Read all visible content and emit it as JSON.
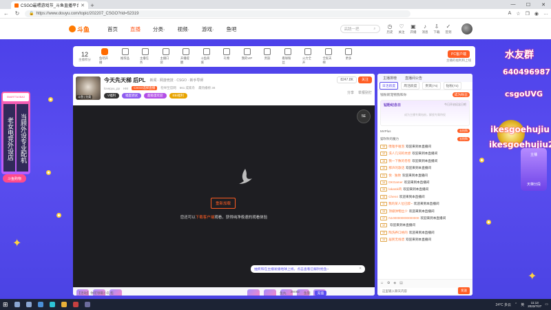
{
  "browser": {
    "tab_title": "CSGO最喂游戏节_斗鱼直播平台",
    "url": "https://www.douyu.com/topic/202207_CSGO?rid=52319"
  },
  "site": {
    "logo": "斗鱼",
    "nav": [
      "首页",
      "直播",
      "分类·",
      "视频·",
      "游戏·",
      "鱼吧"
    ],
    "search_placeholder": "高跷一把",
    "header_icons": [
      "历史",
      "关注",
      "开播",
      "消息",
      "下载",
      "签到"
    ]
  },
  "categories": {
    "rank_value": "12",
    "rank_label": "主播积分",
    "items": [
      "鱼吧开播",
      "推荐品",
      "主播任务",
      "主播口袋",
      "开播提醒",
      "斗鱼商城",
      "礼物",
      "我的VIP",
      "贵族",
      "看球粉丝",
      "火力全开",
      "全民天梯",
      "更多"
    ],
    "pc_button": "PC客户端",
    "pc_sub": "主播的福利和上线"
  },
  "anchor": {
    "name": "今天先天梯 后PL",
    "category": "新闻 · 网游竞技 · CSGO · 新手导师",
    "id_text": "lovepyu_pp",
    "level_text": "HM",
    "tag": "CSGO选择直播",
    "report": "检举至官网",
    "fans": "661 成家舟",
    "hot": "最热播榜 38",
    "pill_v": "V福利",
    "pill_1": "福蛋调试",
    "pill_2": "超级蛋欢迎",
    "pill_3": "EBI福利",
    "follow_count": "8247.8K",
    "follow_btn": "关注",
    "share": "分享",
    "report2": "举报别打",
    "thumb_label": "斗鱼 | 分类"
  },
  "player": {
    "retry": "重新加载",
    "message_prefix": "您还可以",
    "message_link": "下载客户端",
    "message_suffix": "观看，获得纯净极速的观看体验",
    "notice": "抽奖和在主播发播地球上线，点击查看已解封抢鱼~",
    "badge": "5E"
  },
  "chat": {
    "top_left": "主播排榜",
    "top_right": "直播间公告",
    "tabs": [
      "日活跃度",
      "周活跃度",
      "贵宾(74)",
      "钻粉(72)"
    ],
    "fans_text": "钱粉新宠物我和你",
    "fans_btn": "成为粉丝",
    "banner_title": "钻粉纪念日",
    "banner_date": "今日开启纪念日吧",
    "banner_caption": "成为主播专属钻粉，解锁专属特权",
    "feat_1": "MVPlus",
    "feat_2": "猫吹吹的魔力",
    "feat_btn": "去抢购",
    "welcome": "欢迎来到本直播间",
    "messages": [
      {
        "lv": "15",
        "nick": "噗嗤手嗞泡",
        "txt": "欢迎来到本直播间"
      },
      {
        "lv": "12",
        "nick": "洗人几词的坑想",
        "txt": "欢迎来到本直播间"
      },
      {
        "lv": "18",
        "nick": "我一下数的卷卷",
        "txt": "欢迎来到本直播间"
      },
      {
        "lv": "10",
        "nick": "那声的歌话",
        "txt": "欢迎来到本直播间"
      },
      {
        "lv": "21",
        "nick": "悦 · 独致",
        "txt": "欢迎来到本直播间"
      },
      {
        "lv": "14",
        "nick": "DKGamer",
        "txt": "欢迎来到本直播间"
      },
      {
        "lv": "19",
        "nick": "lakatok鸡",
        "txt": "欢迎来到本直播间"
      },
      {
        "lv": "16",
        "nick": "Chen4",
        "txt": "欢迎来到本直播间"
      },
      {
        "lv": "11",
        "nick": "我的某人位已醉~",
        "txt": "欢迎来到本直播间"
      },
      {
        "lv": "13",
        "nick": "顶级弹物丝少",
        "txt": "欢迎来到本直播间"
      },
      {
        "lv": "17",
        "nick": "N1000000000000000",
        "txt": "欢迎来到本直播间"
      },
      {
        "lv": "12",
        "nick": "",
        "txt": "欢迎来到本直播间"
      },
      {
        "lv": "15",
        "nick": "陶洗养口格的",
        "txt": "欢迎来到本直播间"
      },
      {
        "lv": "14",
        "nick": "居民无线谱",
        "txt": "欢迎来到本直播间"
      }
    ],
    "input_placeholder": "这里输入聊天内容",
    "send": "发送"
  },
  "giftbar": {
    "notice": "【活动】你可领取小礼包",
    "count_label": "鱼丸",
    "count_value": "28082",
    "balance": "鱼翅",
    "recharge": "充值"
  },
  "left_overlay": {
    "top": "SMARTTAOBAO",
    "col_1": "老女电竞外设店",
    "col_2": "当顾外设专业配机",
    "button": "斗鱼购物"
  },
  "right_overlay": {
    "line_1": "水友群",
    "line_2": "640496987",
    "line_3": "csgoUVG",
    "line_4": "ikesgoehujiu",
    "line_5": "ikesgoehujiu2",
    "sticker_top": "主播",
    "sticker_bottom": "天梯分段"
  },
  "taskbar": {
    "weather": "24°C 多云",
    "time": "11:13",
    "date": "2022/7/27",
    "lang": "英"
  },
  "colors": {
    "accent": "#ff5d23",
    "site_bg": "#4b43e4",
    "video_bg": "#1e1e22"
  }
}
